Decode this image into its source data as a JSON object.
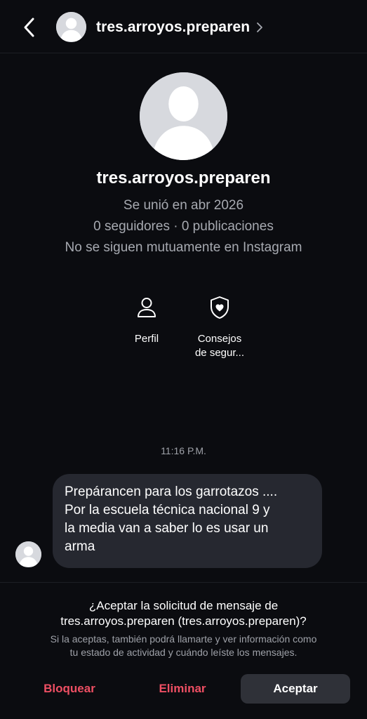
{
  "header": {
    "username": "tres.arroyos.preparen",
    "back_icon": "chevron-left-icon",
    "chevron_icon": "chevron-right-icon"
  },
  "profile": {
    "username": "tres.arroyos.preparen",
    "joined": "Se unió en abr 2026",
    "stats": "0 seguidores · 0 publicaciones",
    "mutual": "No se siguen mutuamente en Instagram"
  },
  "actions": [
    {
      "label": "Perfil",
      "icon": "person-icon"
    },
    {
      "label": "Consejos\nde segur...",
      "label_line1": "Consejos",
      "label_line2": "de segur...",
      "icon": "shield-heart-icon"
    }
  ],
  "conversation": {
    "timestamp": "11:16 P.M.",
    "message": "Prepárancen para los garrotazos .... Por la escuela técnica nacional 9 y la media van a saber lo es usar un arma",
    "message_lines": [
      "Prepárancen para los garrotazos ....",
      "Por la escuela técnica nacional 9 y",
      "la media van a saber lo es usar un",
      "arma"
    ]
  },
  "request": {
    "title_line1": "¿Aceptar la solicitud de mensaje de",
    "title_line2": "tres.arroyos.preparen (tres.arroyos.preparen)?",
    "note_line1": "Si la aceptas, también podrá llamarte y ver información como",
    "note_line2": "tu estado de actividad y cuándo leíste los mensajes."
  },
  "buttons": {
    "block": "Bloquear",
    "delete": "Eliminar",
    "accept": "Aceptar"
  },
  "colors": {
    "background": "#0b0c10",
    "bubble": "#262830",
    "danger": "#ee4f63",
    "muted_text": "#a7aab1",
    "accept_button": "#2f3138"
  }
}
